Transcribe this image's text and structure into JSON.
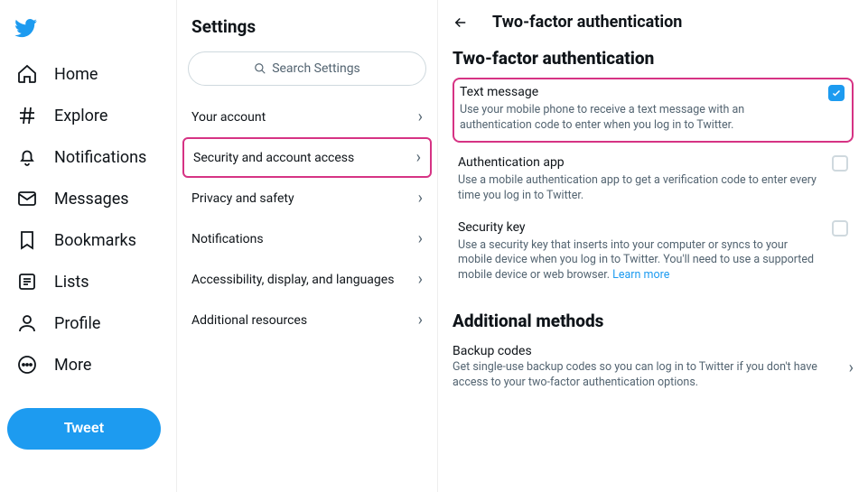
{
  "colors": {
    "accent": "#1d9bf0",
    "highlight": "#d63384",
    "muted": "#536471"
  },
  "nav": {
    "items": [
      {
        "label": "Home",
        "icon": "home-icon"
      },
      {
        "label": "Explore",
        "icon": "hash-icon"
      },
      {
        "label": "Notifications",
        "icon": "bell-icon"
      },
      {
        "label": "Messages",
        "icon": "envelope-icon"
      },
      {
        "label": "Bookmarks",
        "icon": "bookmark-icon"
      },
      {
        "label": "Lists",
        "icon": "list-icon"
      },
      {
        "label": "Profile",
        "icon": "profile-icon"
      },
      {
        "label": "More",
        "icon": "more-icon"
      }
    ],
    "tweet_label": "Tweet"
  },
  "settings": {
    "title": "Settings",
    "search_placeholder": "Search Settings",
    "items": [
      {
        "label": "Your account",
        "highlighted": false
      },
      {
        "label": "Security and account access",
        "highlighted": true
      },
      {
        "label": "Privacy and safety",
        "highlighted": false
      },
      {
        "label": "Notifications",
        "highlighted": false
      },
      {
        "label": "Accessibility, display, and languages",
        "highlighted": false
      },
      {
        "label": "Additional resources",
        "highlighted": false
      }
    ]
  },
  "detail": {
    "page_title": "Two-factor authentication",
    "section_label": "Two-factor authentication",
    "methods": [
      {
        "title": "Text message",
        "desc": "Use your mobile phone to receive a text message with an authentication code to enter when you log in to Twitter.",
        "checked": true,
        "highlighted": true
      },
      {
        "title": "Authentication app",
        "desc": "Use a mobile authentication app to get a verification code to enter every time you log in to Twitter.",
        "checked": false,
        "highlighted": false
      },
      {
        "title": "Security key",
        "desc": "Use a security key that inserts into your computer or syncs to your mobile device when you log in to Twitter. You'll need to use a supported mobile device or web browser. ",
        "learn_more": "Learn more",
        "checked": false,
        "highlighted": false
      }
    ],
    "additional_label": "Additional methods",
    "backup": {
      "title": "Backup codes",
      "desc": "Get single-use backup codes so you can log in to Twitter if you don't have access to your two-factor authentication options."
    }
  }
}
